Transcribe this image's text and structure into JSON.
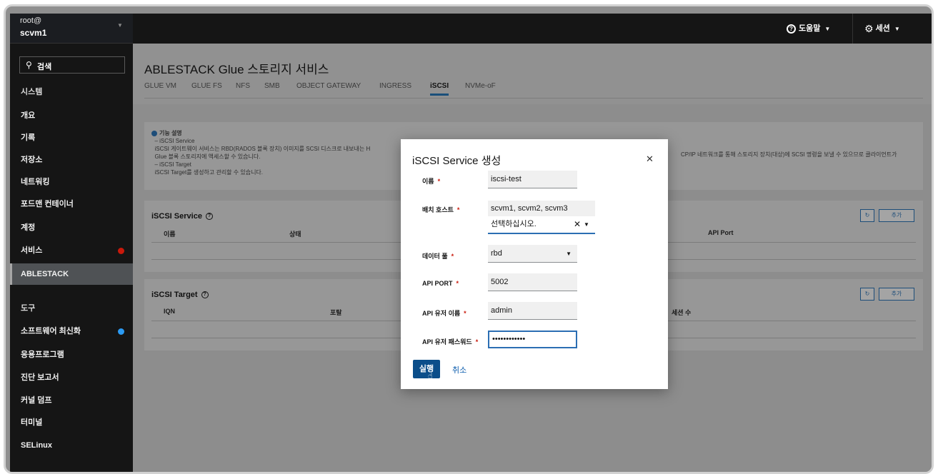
{
  "user": {
    "line1": "root@",
    "line2": "scvm1"
  },
  "sidebar": {
    "search_label": "검색",
    "items": [
      {
        "label": "시스템"
      },
      {
        "label": "개요"
      },
      {
        "label": "기록"
      },
      {
        "label": "저장소"
      },
      {
        "label": "네트워킹"
      },
      {
        "label": "포드맨 컨테이너"
      },
      {
        "label": "계정"
      },
      {
        "label": "서비스"
      },
      {
        "label": "ABLESTACK"
      },
      {
        "label": "도구"
      },
      {
        "label": "소프트웨어 최신화"
      },
      {
        "label": "응용프로그램"
      },
      {
        "label": "진단 보고서"
      },
      {
        "label": "커널 덤프"
      },
      {
        "label": "터미널"
      },
      {
        "label": "SELinux"
      }
    ],
    "badge_colors": {
      "danger": "#c9190b",
      "info": "#2b9af3"
    }
  },
  "topbar": {
    "help_label": "도움말",
    "session_label": "세션"
  },
  "page": {
    "title": "ABLESTACK Glue 스토리지 서비스",
    "tabs": [
      "GLUE VM",
      "GLUE FS",
      "NFS",
      "SMB",
      "OBJECT GATEWAY",
      "INGRESS",
      "iSCSI",
      "NVMe-oF"
    ]
  },
  "description": {
    "heading": "기능 설명",
    "lines": [
      "– iSCSI Service",
      "iSCSI 게이트웨이 서비스는 RBD(RADOS 블록 장치) 이미지를 SCSI 디스크로 내보내는 H",
      "Glue 블록 스토리지에 액세스할 수 있습니다.",
      "– iSCSI Target",
      "iSCSI Target를 생성하고 관리할 수 있습니다."
    ],
    "right_fragment": "CP/IP 네트워크를 통해 스토리지 장치(대상)에 SCSI 명령을 보낼 수 있으므로 클라이언트가"
  },
  "service_card": {
    "title": "iSCSI Service",
    "columns": [
      "이름",
      "상태",
      "API Port"
    ],
    "add_label": "추가",
    "refresh_icon": "refresh-icon"
  },
  "target_card": {
    "title": "iSCSI Target",
    "columns": [
      "IQN",
      "포탈",
      "세션 수"
    ],
    "add_label": "추가",
    "refresh_icon": "refresh-icon"
  },
  "modal": {
    "title": "iSCSI Service 생성",
    "fields": {
      "name": {
        "label": "이름",
        "value": "iscsi-test"
      },
      "hosts": {
        "label": "배치 호스트",
        "chips": "scvm1, scvm2, scvm3",
        "placeholder": "선택하십시오."
      },
      "pool": {
        "label": "데이터 풀",
        "value": "rbd"
      },
      "api_port": {
        "label": "API PORT",
        "value": "5002"
      },
      "api_user": {
        "label": "API 유저 이름",
        "value": "admin"
      },
      "api_password": {
        "label": "API 유저 패스워드",
        "value": "••••••••••••"
      }
    },
    "run_label": "실행",
    "cancel_label": "취소"
  }
}
